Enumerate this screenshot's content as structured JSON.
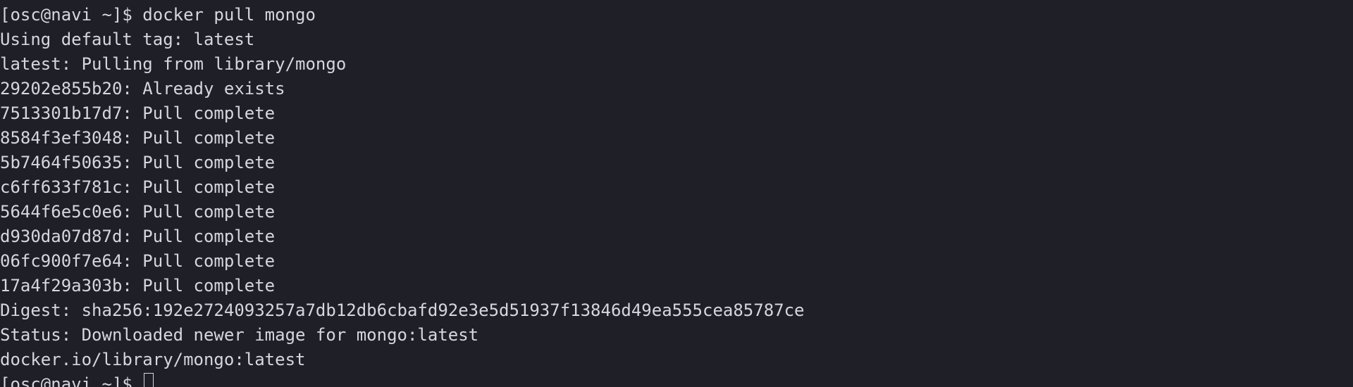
{
  "terminal": {
    "lines": [
      "[osc@navi ~]$ docker pull mongo",
      "Using default tag: latest",
      "latest: Pulling from library/mongo",
      "29202e855b20: Already exists",
      "7513301b17d7: Pull complete",
      "8584f3ef3048: Pull complete",
      "5b7464f50635: Pull complete",
      "c6ff633f781c: Pull complete",
      "5644f6e5c0e6: Pull complete",
      "d930da07d87d: Pull complete",
      "06fc900f7e64: Pull complete",
      "17a4f29a303b: Pull complete",
      "Digest: sha256:192e2724093257a7db12db6cbafd92e3e5d51937f13846d49ea555cea85787ce",
      "Status: Downloaded newer image for mongo:latest",
      "docker.io/library/mongo:latest"
    ],
    "prompt": "[osc@navi ~]$ ",
    "colors": {
      "background": "#1f1f28",
      "foreground": "#d6d6dc"
    }
  }
}
